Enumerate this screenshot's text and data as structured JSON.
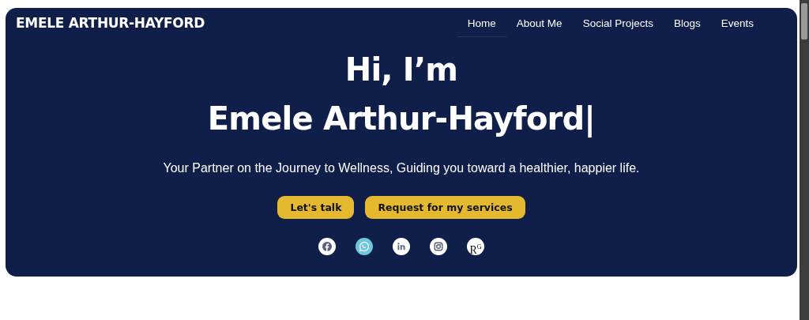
{
  "brand": "EMELE ARTHUR-HAYFORD",
  "nav": [
    {
      "label": "Home",
      "selected": true
    },
    {
      "label": "About Me",
      "selected": false
    },
    {
      "label": "Social Projects",
      "selected": false
    },
    {
      "label": "Blogs",
      "selected": false
    },
    {
      "label": "Events",
      "selected": false
    }
  ],
  "hero": {
    "greeting": "Hi, I’m",
    "name": "Emele Arthur-Hayford|",
    "tagline": "Your Partner on the Journey to Wellness, Guiding you toward a healthier, happier life."
  },
  "buttons": [
    "Let's talk",
    "Request for my services"
  ],
  "social": [
    {
      "kind": "facebook",
      "selected": false
    },
    {
      "kind": "whatsapp",
      "selected": true
    },
    {
      "kind": "linkedin",
      "selected": false
    },
    {
      "kind": "instagram",
      "selected": false
    },
    {
      "kind": "researchgate",
      "label": "R$^{G}$",
      "selected": false
    }
  ]
}
